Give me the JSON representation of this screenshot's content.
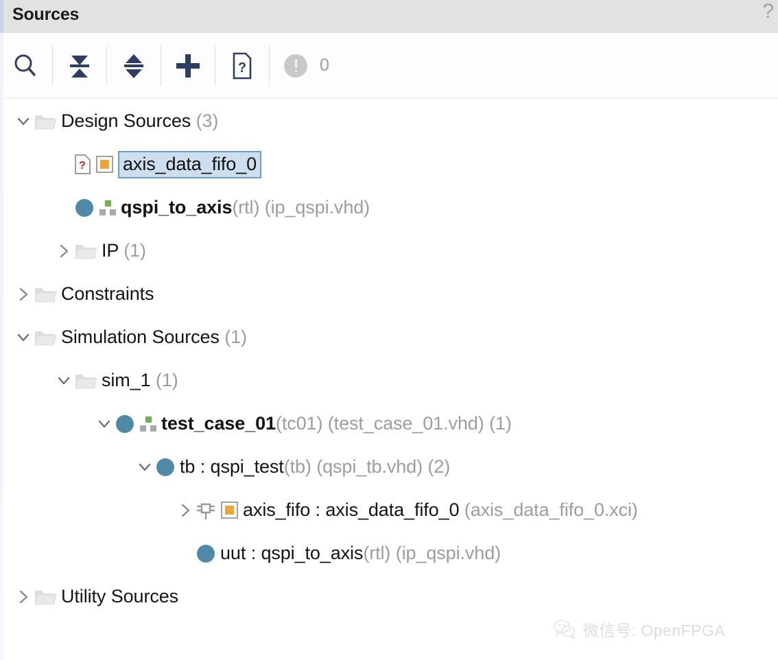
{
  "panel": {
    "title": "Sources",
    "help_icon": "question-mark-icon",
    "accent_color": "#6e9cc4",
    "titlebar_color": "#e2e2e2"
  },
  "toolbar": {
    "buttons": [
      {
        "name": "search-icon",
        "tooltip": "Search"
      },
      {
        "name": "collapse-all-icon",
        "tooltip": "Collapse All"
      },
      {
        "name": "expand-all-icon",
        "tooltip": "Expand All"
      },
      {
        "name": "add-sources-icon",
        "tooltip": "Add Sources"
      },
      {
        "name": "file-question-icon",
        "tooltip": "Report Missing Files"
      }
    ],
    "alert": {
      "icon": "warning-circle-icon",
      "count": "0",
      "color": "#c9c9c9"
    }
  },
  "tree": {
    "rows": [
      {
        "id": "design-sources",
        "indent": 0,
        "twisty": "expanded",
        "icon": "folder-icon",
        "name": "Design Sources",
        "count": "(3)",
        "bold": false,
        "selected": false
      },
      {
        "id": "axis-data-fifo-0",
        "indent": 1,
        "twisty": "none",
        "icon": "file-question-icon",
        "icon2": "orange-square-icon",
        "name": "axis_data_fifo_0",
        "count": "",
        "bold": false,
        "selected": true
      },
      {
        "id": "qspi-to-axis",
        "indent": 1,
        "twisty": "none",
        "icon": "vhdl-circle-icon",
        "icon2": "hierarchy-icon",
        "name": "qspi_to_axis",
        "arch": "(rtl)",
        "file": "(ip_qspi.vhd)",
        "count": "",
        "bold": true,
        "selected": false
      },
      {
        "id": "ip",
        "indent": 1,
        "twisty": "collapsed",
        "icon": "folder-icon",
        "name": "IP",
        "count": "(1)",
        "bold": false,
        "selected": false
      },
      {
        "id": "constraints",
        "indent": 0,
        "twisty": "collapsed",
        "icon": "folder-icon",
        "name": "Constraints",
        "count": "",
        "bold": false,
        "selected": false
      },
      {
        "id": "simulation-sources",
        "indent": 0,
        "twisty": "expanded",
        "icon": "folder-icon",
        "name": "Simulation Sources",
        "count": "(1)",
        "bold": false,
        "selected": false
      },
      {
        "id": "sim-1",
        "indent": 1,
        "twisty": "expanded",
        "icon": "folder-icon",
        "name": "sim_1",
        "count": "(1)",
        "bold": false,
        "selected": false
      },
      {
        "id": "test-case-01",
        "indent": 2,
        "twisty": "expanded",
        "icon": "vhdl-circle-icon",
        "icon2": "hierarchy-icon",
        "name": "test_case_01",
        "arch": "(tc01)",
        "file": "(test_case_01.vhd)",
        "count": "(1)",
        "bold": true,
        "selected": false
      },
      {
        "id": "tb-qspi-test",
        "indent": 3,
        "twisty": "expanded",
        "icon": "vhdl-circle-icon",
        "name": "tb : qspi_test",
        "arch": "(tb)",
        "file": "(qspi_tb.vhd)",
        "count": "(2)",
        "bold": false,
        "selected": false
      },
      {
        "id": "axis-fifo-inst",
        "indent": 4,
        "twisty": "collapsed",
        "icon": "ip-core-icon",
        "icon2": "orange-square-icon",
        "name": "axis_fifo : axis_data_fifo_0",
        "arch": "",
        "file": "(axis_data_fifo_0.xci)",
        "count": "",
        "bold": false,
        "selected": false
      },
      {
        "id": "uut-qspi-to-axis",
        "indent": 4,
        "twisty": "none",
        "icon": "vhdl-circle-icon",
        "name": "uut : qspi_to_axis",
        "arch": "(rtl)",
        "file": "(ip_qspi.vhd)",
        "count": "",
        "bold": false,
        "selected": false
      },
      {
        "id": "utility-sources",
        "indent": 0,
        "twisty": "collapsed",
        "icon": "folder-icon",
        "name": "Utility Sources",
        "count": "",
        "bold": false,
        "selected": false
      }
    ]
  },
  "watermark": {
    "icon": "wechat-icon",
    "text": "微信号: OpenFPGA"
  }
}
